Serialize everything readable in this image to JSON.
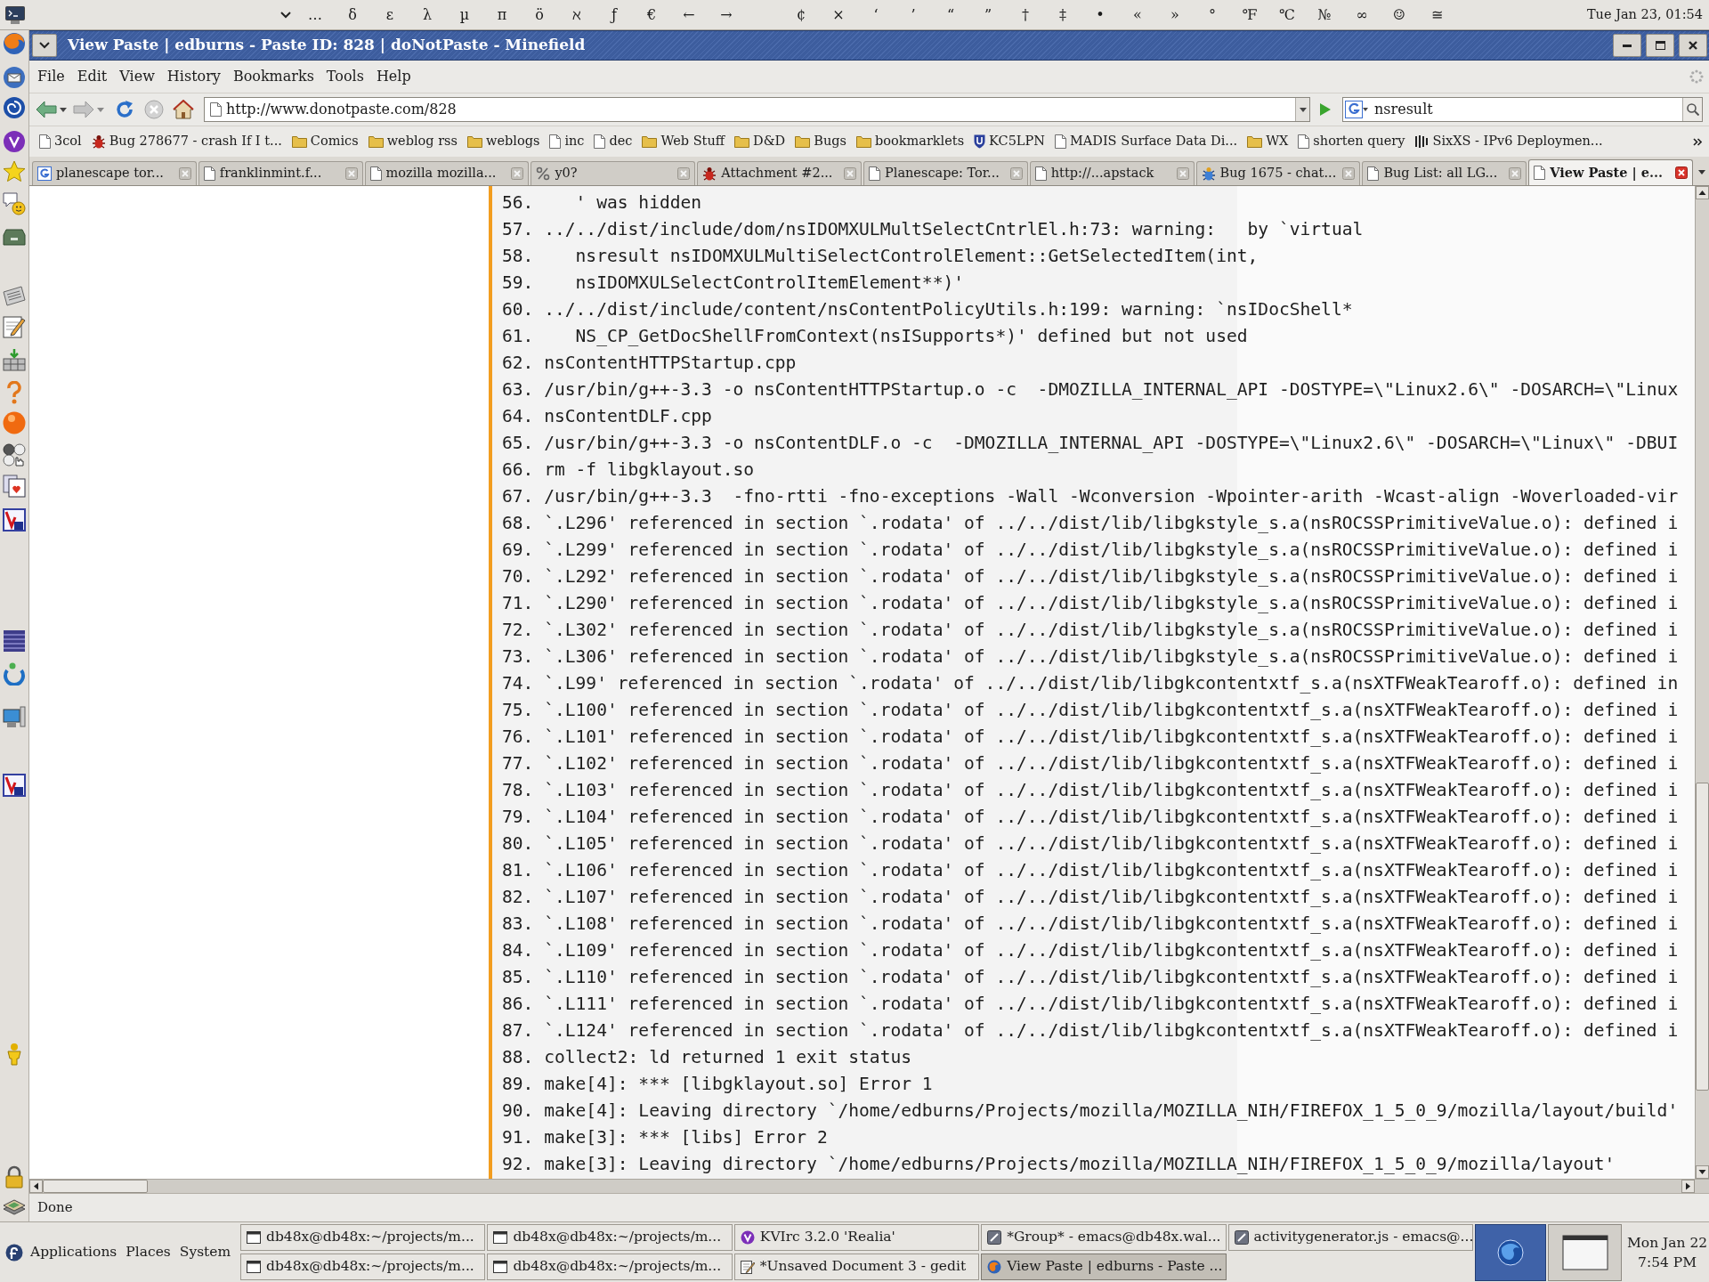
{
  "top_panel": {
    "palette_groups": [
      [
        "…",
        "δ",
        "ε",
        "λ",
        "µ",
        "π",
        "ö",
        "ℵ",
        "ƒ",
        "€",
        "←",
        "→"
      ],
      [
        "¢",
        "×",
        "‘",
        "’",
        "“",
        "”",
        "†",
        "‡",
        "•",
        "«",
        "»",
        "°",
        "℉",
        "℃",
        "№",
        "∞",
        "☺",
        "≅"
      ]
    ],
    "clock": "Tue Jan 23, 01:54"
  },
  "window": {
    "title": "View Paste | edburns - Paste ID: 828 | doNotPaste - Minefield"
  },
  "menu": [
    {
      "label": "File"
    },
    {
      "label": "Edit"
    },
    {
      "label": "View"
    },
    {
      "label": "History"
    },
    {
      "label": "Bookmarks"
    },
    {
      "label": "Tools"
    },
    {
      "label": "Help"
    }
  ],
  "navigation": {
    "url": "http://www.donotpaste.com/828",
    "search": "nsresult"
  },
  "bookmarks": [
    {
      "label": "3col",
      "kind": "page"
    },
    {
      "label": "Bug 278677 - crash If I t...",
      "kind": "bug"
    },
    {
      "label": "Comics",
      "kind": "folder"
    },
    {
      "label": "weblog rss",
      "kind": "folder"
    },
    {
      "label": "weblogs",
      "kind": "folder"
    },
    {
      "label": "inc",
      "kind": "page"
    },
    {
      "label": "dec",
      "kind": "page"
    },
    {
      "label": "Web Stuff",
      "kind": "folder"
    },
    {
      "label": "D&D",
      "kind": "folder"
    },
    {
      "label": "Bugs",
      "kind": "folder"
    },
    {
      "label": "bookmarklets",
      "kind": "folder"
    },
    {
      "label": "KC5LPN",
      "kind": "shield"
    },
    {
      "label": "MADIS Surface Data Di...",
      "kind": "page"
    },
    {
      "label": "WX",
      "kind": "folder"
    },
    {
      "label": "shorten query",
      "kind": "page"
    },
    {
      "label": "SixXS - IPv6 Deploymen...",
      "kind": "bars"
    }
  ],
  "tabs": [
    {
      "label": "planescape tor...",
      "kind": "arc",
      "selected": false
    },
    {
      "label": "franklinmint.f...",
      "kind": "page",
      "selected": false
    },
    {
      "label": "mozilla mozilla...",
      "kind": "page",
      "selected": false
    },
    {
      "label": "y0?",
      "kind": "percent",
      "selected": false
    },
    {
      "label": "Attachment #2...",
      "kind": "bug",
      "selected": false
    },
    {
      "label": "Planescape: Tor...",
      "kind": "page",
      "selected": false
    },
    {
      "label": "http://...apstack",
      "kind": "page",
      "selected": false
    },
    {
      "label": "Bug 1675 - chat...",
      "kind": "bluebug",
      "selected": false
    },
    {
      "label": "Bug List: all LG...",
      "kind": "page",
      "selected": false
    },
    {
      "label": "View Paste | e...",
      "kind": "page",
      "selected": true
    }
  ],
  "code_lines": [
    {
      "number": "56.",
      "text": "   ' was hidden"
    },
    {
      "number": "57.",
      "text": "../../dist/include/dom/nsIDOMXULMultSelectCntrlEl.h:73: warning:   by `virtual"
    },
    {
      "number": "58.",
      "text": "   nsresult nsIDOMXULMultiSelectControlElement::GetSelectedItem(int,"
    },
    {
      "number": "59.",
      "text": "   nsIDOMXULSelectControlItemElement**)'"
    },
    {
      "number": "60.",
      "text": "../../dist/include/content/nsContentPolicyUtils.h:199: warning: `nsIDocShell*"
    },
    {
      "number": "61.",
      "text": "   NS_CP_GetDocShellFromContext(nsISupports*)' defined but not used"
    },
    {
      "number": "62.",
      "text": "nsContentHTTPStartup.cpp"
    },
    {
      "number": "63.",
      "text": "/usr/bin/g++-3.3 -o nsContentHTTPStartup.o -c  -DMOZILLA_INTERNAL_API -DOSTYPE=\\\"Linux2.6\\\" -DOSARCH=\\\"Linux"
    },
    {
      "number": "64.",
      "text": "nsContentDLF.cpp"
    },
    {
      "number": "65.",
      "text": "/usr/bin/g++-3.3 -o nsContentDLF.o -c  -DMOZILLA_INTERNAL_API -DOSTYPE=\\\"Linux2.6\\\" -DOSARCH=\\\"Linux\\\" -DBUI"
    },
    {
      "number": "66.",
      "text": "rm -f libgklayout.so"
    },
    {
      "number": "67.",
      "text": "/usr/bin/g++-3.3  -fno-rtti -fno-exceptions -Wall -Wconversion -Wpointer-arith -Wcast-align -Woverloaded-vir"
    },
    {
      "number": "68.",
      "text": "`.L296' referenced in section `.rodata' of ../../dist/lib/libgkstyle_s.a(nsROCSSPrimitiveValue.o): defined i"
    },
    {
      "number": "69.",
      "text": "`.L299' referenced in section `.rodata' of ../../dist/lib/libgkstyle_s.a(nsROCSSPrimitiveValue.o): defined i"
    },
    {
      "number": "70.",
      "text": "`.L292' referenced in section `.rodata' of ../../dist/lib/libgkstyle_s.a(nsROCSSPrimitiveValue.o): defined i"
    },
    {
      "number": "71.",
      "text": "`.L290' referenced in section `.rodata' of ../../dist/lib/libgkstyle_s.a(nsROCSSPrimitiveValue.o): defined i"
    },
    {
      "number": "72.",
      "text": "`.L302' referenced in section `.rodata' of ../../dist/lib/libgkstyle_s.a(nsROCSSPrimitiveValue.o): defined i"
    },
    {
      "number": "73.",
      "text": "`.L306' referenced in section `.rodata' of ../../dist/lib/libgkstyle_s.a(nsROCSSPrimitiveValue.o): defined i"
    },
    {
      "number": "74.",
      "text": "`.L99' referenced in section `.rodata' of ../../dist/lib/libgkcontentxtf_s.a(nsXTFWeakTearoff.o): defined in"
    },
    {
      "number": "75.",
      "text": "`.L100' referenced in section `.rodata' of ../../dist/lib/libgkcontentxtf_s.a(nsXTFWeakTearoff.o): defined i"
    },
    {
      "number": "76.",
      "text": "`.L101' referenced in section `.rodata' of ../../dist/lib/libgkcontentxtf_s.a(nsXTFWeakTearoff.o): defined i"
    },
    {
      "number": "77.",
      "text": "`.L102' referenced in section `.rodata' of ../../dist/lib/libgkcontentxtf_s.a(nsXTFWeakTearoff.o): defined i"
    },
    {
      "number": "78.",
      "text": "`.L103' referenced in section `.rodata' of ../../dist/lib/libgkcontentxtf_s.a(nsXTFWeakTearoff.o): defined i"
    },
    {
      "number": "79.",
      "text": "`.L104' referenced in section `.rodata' of ../../dist/lib/libgkcontentxtf_s.a(nsXTFWeakTearoff.o): defined i"
    },
    {
      "number": "80.",
      "text": "`.L105' referenced in section `.rodata' of ../../dist/lib/libgkcontentxtf_s.a(nsXTFWeakTearoff.o): defined i"
    },
    {
      "number": "81.",
      "text": "`.L106' referenced in section `.rodata' of ../../dist/lib/libgkcontentxtf_s.a(nsXTFWeakTearoff.o): defined i"
    },
    {
      "number": "82.",
      "text": "`.L107' referenced in section `.rodata' of ../../dist/lib/libgkcontentxtf_s.a(nsXTFWeakTearoff.o): defined i"
    },
    {
      "number": "83.",
      "text": "`.L108' referenced in section `.rodata' of ../../dist/lib/libgkcontentxtf_s.a(nsXTFWeakTearoff.o): defined i"
    },
    {
      "number": "84.",
      "text": "`.L109' referenced in section `.rodata' of ../../dist/lib/libgkcontentxtf_s.a(nsXTFWeakTearoff.o): defined i"
    },
    {
      "number": "85.",
      "text": "`.L110' referenced in section `.rodata' of ../../dist/lib/libgkcontentxtf_s.a(nsXTFWeakTearoff.o): defined i"
    },
    {
      "number": "86.",
      "text": "`.L111' referenced in section `.rodata' of ../../dist/lib/libgkcontentxtf_s.a(nsXTFWeakTearoff.o): defined i"
    },
    {
      "number": "87.",
      "text": "`.L124' referenced in section `.rodata' of ../../dist/lib/libgkcontentxtf_s.a(nsXTFWeakTearoff.o): defined i"
    },
    {
      "number": "88.",
      "text": "collect2: ld returned 1 exit status"
    },
    {
      "number": "89.",
      "text": "make[4]: *** [libgklayout.so] Error 1"
    },
    {
      "number": "90.",
      "text": "make[4]: Leaving directory `/home/edburns/Projects/mozilla/MOZILLA_NIH/FIREFOX_1_5_0_9/mozilla/layout/build'"
    },
    {
      "number": "91.",
      "text": "make[3]: *** [libs] Error 2"
    },
    {
      "number": "92.",
      "text": "make[3]: Leaving directory `/home/edburns/Projects/mozilla/MOZILLA_NIH/FIREFOX_1_5_0_9/mozilla/layout'"
    }
  ],
  "status_bar": {
    "text": "Done"
  },
  "bottom_panel": {
    "menus": [
      "Applications",
      "Places",
      "System"
    ],
    "windows": [
      {
        "label": "db48x@db48x:~/projects/m...",
        "kind": "terminal",
        "selected": false
      },
      {
        "label": "db48x@db48x:~/projects/m...",
        "kind": "terminal",
        "selected": false
      },
      {
        "label": "KVIrc 3.2.0 'Realia'",
        "kind": "chat",
        "selected": false
      },
      {
        "label": "*Group* - emacs@db48x.wal...",
        "kind": "editor",
        "selected": false
      },
      {
        "label": "activitygenerator.js - emacs@...",
        "kind": "editor",
        "selected": false
      },
      {
        "label": "db48x@db48x:~/projects/m...",
        "kind": "terminal",
        "selected": false
      },
      {
        "label": "db48x@db48x:~/projects/m...",
        "kind": "terminal",
        "selected": false
      },
      {
        "label": "*Unsaved Document 3 - gedit",
        "kind": "notepad",
        "selected": false
      },
      {
        "label": "View Paste | edburns - Paste ...",
        "kind": "browser",
        "selected": true
      }
    ],
    "workspaces": [
      {
        "kind": "globe",
        "selected": true
      },
      {
        "kind": "window",
        "selected": false
      }
    ],
    "clock": {
      "date": "Mon Jan 22",
      "time": "7:54 PM"
    }
  }
}
